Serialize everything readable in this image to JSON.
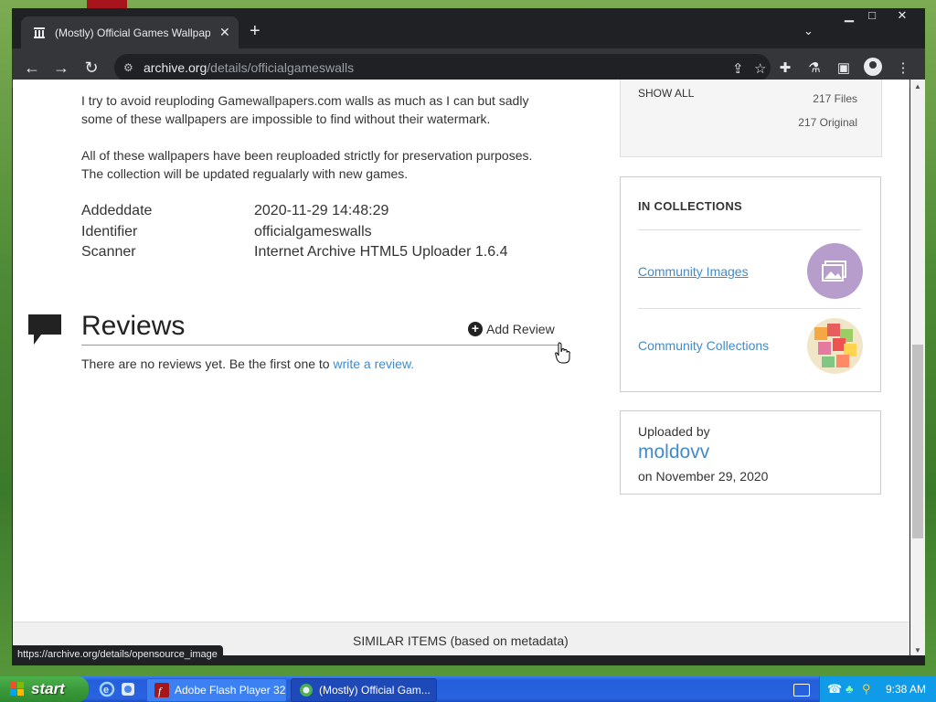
{
  "browser": {
    "tab_title": "(Mostly) Official Games Wallpapers",
    "tab_close": "✕",
    "new_tab": "+",
    "url_host": "archive.org",
    "url_path": "/details/officialgameswalls",
    "window_controls": {
      "minimize": "▁",
      "maximize": "□",
      "close": "✕"
    },
    "status_url": "https://archive.org/details/opensource_image"
  },
  "description": {
    "para1_line1": "I try to avoid reuploding Gamewallpapers.com walls as much as I can but sadly",
    "para1_line2": "some of these wallpapers are impossible to find without their watermark.",
    "para2_line1": "All of these wallpapers have been reuploaded strictly for preservation purposes.",
    "para2_line2": "The collection will be updated regualarly with new games."
  },
  "metadata": [
    {
      "label": "Addeddate",
      "value": "2020-11-29 14:48:29"
    },
    {
      "label": "Identifier",
      "value": "officialgameswalls"
    },
    {
      "label": "Scanner",
      "value": "Internet Archive HTML5 Uploader 1.6.4"
    }
  ],
  "reviews": {
    "title": "Reviews",
    "add_review": "Add Review",
    "none_text": "There are no reviews yet. Be the first one to ",
    "write_link": "write a review."
  },
  "files": {
    "show_all": "SHOW ALL",
    "files_count": "217 Files",
    "original_count": "217 Original"
  },
  "collections": {
    "heading": "IN COLLECTIONS",
    "items": [
      {
        "label": "Community Images"
      },
      {
        "label": "Community Collections"
      }
    ]
  },
  "uploader": {
    "label": "Uploaded by",
    "name": "moldovv",
    "date": "on November 29, 2020"
  },
  "similar": {
    "label": "SIMILAR ITEMS (based on metadata)"
  },
  "taskbar": {
    "start": "start",
    "tasks": [
      {
        "label": "Adobe Flash Player 32"
      },
      {
        "label": "(Mostly) Official Gam..."
      }
    ],
    "time": "9:38 AM"
  }
}
